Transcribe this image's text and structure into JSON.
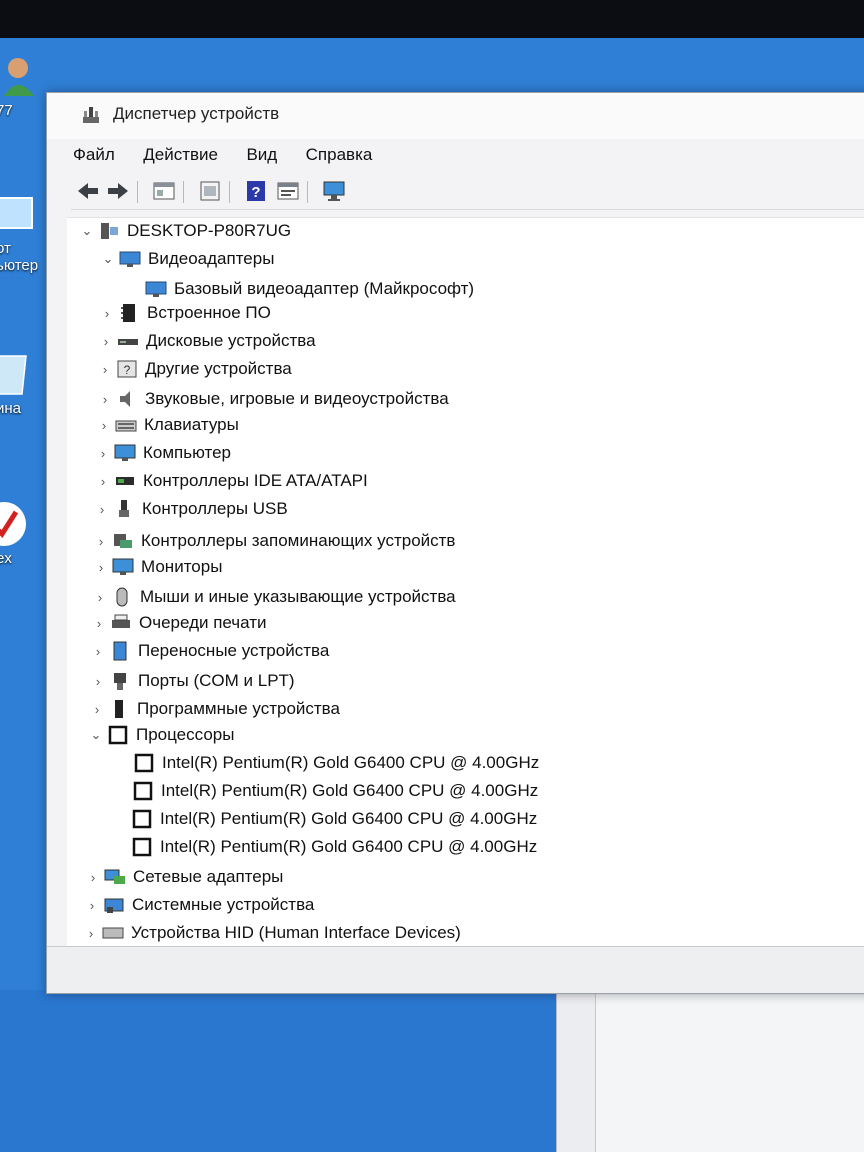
{
  "desktop": {
    "icons": [
      {
        "label": "77"
      },
      {
        "label": "ьютер",
        "label_top": "от"
      },
      {
        "label": "ина"
      },
      {
        "label": "ex"
      }
    ]
  },
  "window": {
    "title": "Диспетчер устройств",
    "menu": [
      "Файл",
      "Действие",
      "Вид",
      "Справка"
    ],
    "toolbar": [
      "back-icon",
      "forward-icon",
      "properties-icon",
      "show-hidden-icon",
      "help-icon",
      "update-driver-icon",
      "monitor-icon"
    ],
    "tree": [
      {
        "label": "DESKTOP-P80R7UG",
        "level": 0,
        "expanded": true,
        "icon": "computer-icon"
      },
      {
        "label": "Видеоадаптеры",
        "level": 1,
        "expanded": true,
        "icon": "display-adapter-icon"
      },
      {
        "label": "Базовый видеоадаптер (Майкрософт)",
        "level": 2,
        "icon": "display-adapter-icon"
      },
      {
        "label": "Встроенное ПО",
        "level": 1,
        "expanded": false,
        "icon": "firmware-icon"
      },
      {
        "label": "Дисковые устройства",
        "level": 1,
        "expanded": false,
        "icon": "disk-icon"
      },
      {
        "label": "Другие устройства",
        "level": 1,
        "expanded": false,
        "icon": "other-devices-icon"
      },
      {
        "label": "Звуковые, игровые и видеоустройства",
        "level": 1,
        "expanded": false,
        "icon": "sound-icon"
      },
      {
        "label": "Клавиатуры",
        "level": 1,
        "expanded": false,
        "icon": "keyboard-icon"
      },
      {
        "label": "Компьютер",
        "level": 1,
        "expanded": false,
        "icon": "monitor-icon"
      },
      {
        "label": "Контроллеры IDE ATA/ATAPI",
        "level": 1,
        "expanded": false,
        "icon": "ide-icon"
      },
      {
        "label": "Контроллеры USB",
        "level": 1,
        "expanded": false,
        "icon": "usb-icon"
      },
      {
        "label": "Контроллеры запоминающих устройств",
        "level": 1,
        "expanded": false,
        "icon": "storage-controller-icon"
      },
      {
        "label": "Мониторы",
        "level": 1,
        "expanded": false,
        "icon": "monitor-icon"
      },
      {
        "label": "Мыши и иные указывающие устройства",
        "level": 1,
        "expanded": false,
        "icon": "mouse-icon"
      },
      {
        "label": "Очереди печати",
        "level": 1,
        "expanded": false,
        "icon": "printer-icon"
      },
      {
        "label": "Переносные устройства",
        "level": 1,
        "expanded": false,
        "icon": "portable-device-icon"
      },
      {
        "label": "Порты (COM и LPT)",
        "level": 1,
        "expanded": false,
        "icon": "port-icon"
      },
      {
        "label": "Программные устройства",
        "level": 1,
        "expanded": false,
        "icon": "software-device-icon"
      },
      {
        "label": "Процессоры",
        "level": 1,
        "expanded": true,
        "icon": "processor-icon"
      },
      {
        "label": "Intel(R) Pentium(R) Gold G6400 CPU @ 4.00GHz",
        "level": 2,
        "icon": "processor-icon"
      },
      {
        "label": "Intel(R) Pentium(R) Gold G6400 CPU @ 4.00GHz",
        "level": 2,
        "icon": "processor-icon"
      },
      {
        "label": "Intel(R) Pentium(R) Gold G6400 CPU @ 4.00GHz",
        "level": 2,
        "icon": "processor-icon"
      },
      {
        "label": "Intel(R) Pentium(R) Gold G6400 CPU @ 4.00GHz",
        "level": 2,
        "icon": "processor-icon"
      },
      {
        "label": "Сетевые адаптеры",
        "level": 1,
        "expanded": false,
        "icon": "network-icon"
      },
      {
        "label": "Системные устройства",
        "level": 1,
        "expanded": false,
        "icon": "system-device-icon"
      },
      {
        "label": "Устройства HID (Human Interface Devices)",
        "level": 1,
        "expanded": false,
        "icon": "hid-icon"
      }
    ]
  }
}
